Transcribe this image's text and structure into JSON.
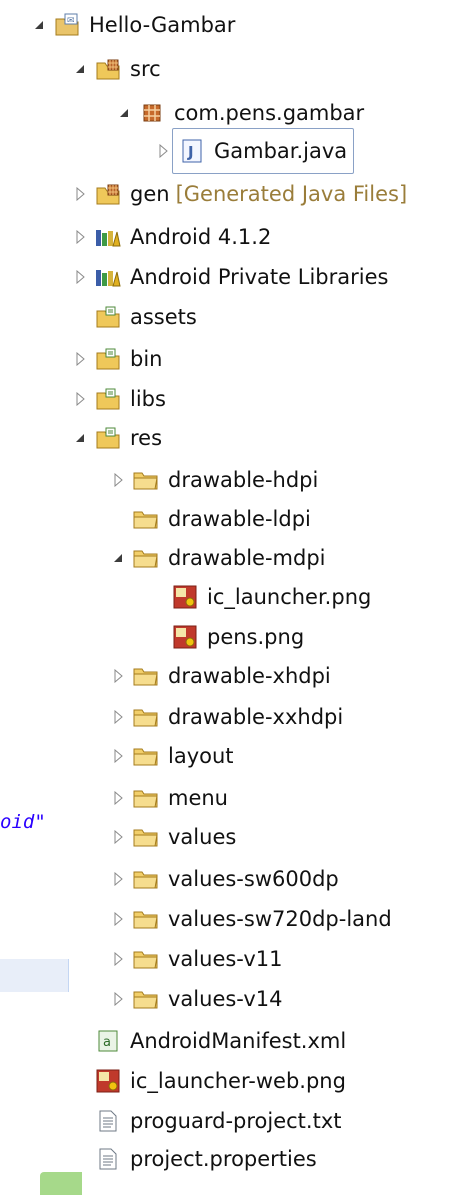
{
  "editor_fragment": {
    "code_text": "oid\""
  },
  "tree": [
    {
      "label": "Hello-Gambar",
      "icon": "project-icon",
      "state": "expanded"
    },
    {
      "label": "src",
      "icon": "source-folder-icon",
      "state": "expanded"
    },
    {
      "label": "com.pens.gambar",
      "icon": "package-icon",
      "state": "expanded"
    },
    {
      "label": "Gambar.java",
      "icon": "java-file-icon",
      "state": "collapsed",
      "selected": true
    },
    {
      "label": "gen",
      "decoration": "[Generated Java Files]",
      "icon": "source-folder-icon",
      "state": "collapsed"
    },
    {
      "label": "Android 4.1.2",
      "icon": "library-icon",
      "state": "collapsed"
    },
    {
      "label": "Android Private Libraries",
      "icon": "library-icon",
      "state": "collapsed"
    },
    {
      "label": "assets",
      "icon": "folder-icon",
      "state": "none"
    },
    {
      "label": "bin",
      "icon": "folder-icon",
      "state": "collapsed"
    },
    {
      "label": "libs",
      "icon": "folder-icon",
      "state": "collapsed"
    },
    {
      "label": "res",
      "icon": "folder-icon",
      "state": "expanded"
    },
    {
      "label": "drawable-hdpi",
      "icon": "plain-folder-icon",
      "state": "collapsed"
    },
    {
      "label": "drawable-ldpi",
      "icon": "plain-folder-icon",
      "state": "none"
    },
    {
      "label": "drawable-mdpi",
      "icon": "plain-folder-icon",
      "state": "expanded"
    },
    {
      "label": "ic_launcher.png",
      "icon": "image-file-icon",
      "state": "none"
    },
    {
      "label": "pens.png",
      "icon": "image-file-icon",
      "state": "none"
    },
    {
      "label": "drawable-xhdpi",
      "icon": "plain-folder-icon",
      "state": "collapsed"
    },
    {
      "label": "drawable-xxhdpi",
      "icon": "plain-folder-icon",
      "state": "collapsed"
    },
    {
      "label": "layout",
      "icon": "plain-folder-icon",
      "state": "collapsed"
    },
    {
      "label": "menu",
      "icon": "plain-folder-icon",
      "state": "collapsed"
    },
    {
      "label": "values",
      "icon": "plain-folder-icon",
      "state": "collapsed"
    },
    {
      "label": "values-sw600dp",
      "icon": "plain-folder-icon",
      "state": "collapsed"
    },
    {
      "label": "values-sw720dp-land",
      "icon": "plain-folder-icon",
      "state": "collapsed"
    },
    {
      "label": "values-v11",
      "icon": "plain-folder-icon",
      "state": "collapsed"
    },
    {
      "label": "values-v14",
      "icon": "plain-folder-icon",
      "state": "collapsed"
    },
    {
      "label": "AndroidManifest.xml",
      "icon": "manifest-file-icon",
      "state": "none"
    },
    {
      "label": "ic_launcher-web.png",
      "icon": "image-file-icon",
      "state": "none"
    },
    {
      "label": "proguard-project.txt",
      "icon": "text-file-icon",
      "state": "none"
    },
    {
      "label": "project.properties",
      "icon": "text-file-icon",
      "state": "none"
    }
  ]
}
